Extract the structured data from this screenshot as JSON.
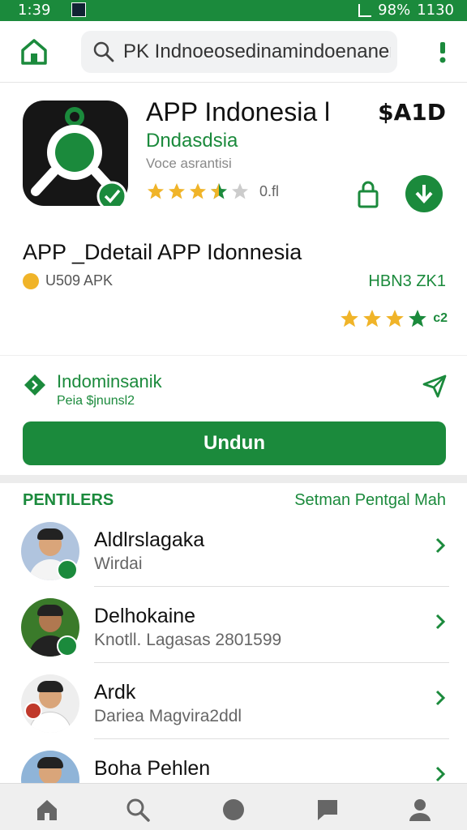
{
  "status_bar": {
    "time": "1:39",
    "battery": "98%",
    "clock_right": "1130"
  },
  "search": {
    "value": "PK Indnoeosedinamindoenanen"
  },
  "app": {
    "name": "APP Indonesia l",
    "price": "$A1D",
    "developer": "Dndasdsia",
    "meta": "Voce asrantisi",
    "rating_count": "0.fl",
    "rating": 3.5
  },
  "detail": {
    "title": "APP _Ddetail APP Idonnesia",
    "apk_label": "U509 APK",
    "version": "HBN3 ZK1",
    "rating_count": "c2"
  },
  "publisher": {
    "name": "Indominsanik",
    "sub": "Peia $jnunsl2"
  },
  "install_button": "Undun",
  "section": {
    "title": "PENTILERS",
    "link": "Setman Pentgal Mah"
  },
  "list": [
    {
      "name": "Aldlrslagaka",
      "sub": "Wirdai"
    },
    {
      "name": "Delhokaine",
      "sub": "Knotll. Lagasas 2801599"
    },
    {
      "name": "Ardk",
      "sub": "Dariea Magvira2ddl"
    },
    {
      "name": "Boha Pehlen",
      "sub": ""
    }
  ],
  "icons": {
    "home": "home-icon",
    "search": "search-icon",
    "more": "more-vert-icon",
    "lock": "lock-icon",
    "download": "download-icon",
    "share": "send-icon",
    "chevron": "chevron-right-icon",
    "nav": [
      "home-icon",
      "search-icon",
      "circle-icon",
      "chat-icon",
      "person-icon"
    ]
  },
  "colors": {
    "accent": "#1b8a3c",
    "star": "#f0b429"
  }
}
